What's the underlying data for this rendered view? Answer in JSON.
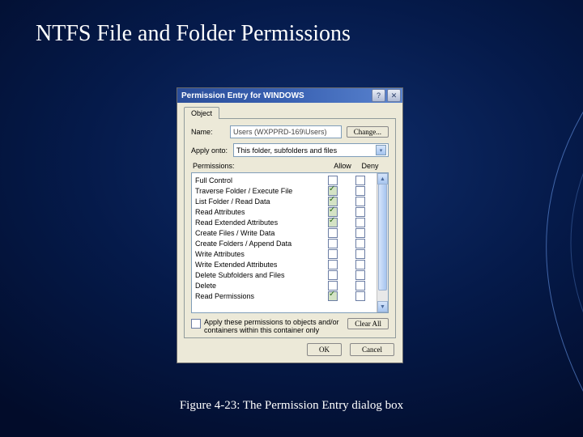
{
  "slide": {
    "title": "NTFS File and Folder Permissions",
    "caption": "Figure 4-23: The Permission Entry dialog box"
  },
  "dialog": {
    "title": "Permission Entry for WINDOWS",
    "help": "?",
    "close": "✕",
    "tab": "Object",
    "name_label": "Name:",
    "name_value": "Users (WXPPRD-169\\Users)",
    "change_btn": "Change...",
    "apply_label": "Apply onto:",
    "apply_value": "This folder, subfolders and files",
    "perm_header": "Permissions:",
    "allow_header": "Allow",
    "deny_header": "Deny",
    "permissions": [
      {
        "name": "Full Control",
        "allow": false,
        "deny": false
      },
      {
        "name": "Traverse Folder / Execute File",
        "allow": true,
        "deny": false
      },
      {
        "name": "List Folder / Read Data",
        "allow": true,
        "deny": false
      },
      {
        "name": "Read Attributes",
        "allow": true,
        "deny": false
      },
      {
        "name": "Read Extended Attributes",
        "allow": true,
        "deny": false
      },
      {
        "name": "Create Files / Write Data",
        "allow": false,
        "deny": false
      },
      {
        "name": "Create Folders / Append Data",
        "allow": false,
        "deny": false
      },
      {
        "name": "Write Attributes",
        "allow": false,
        "deny": false
      },
      {
        "name": "Write Extended Attributes",
        "allow": false,
        "deny": false
      },
      {
        "name": "Delete Subfolders and Files",
        "allow": false,
        "deny": false
      },
      {
        "name": "Delete",
        "allow": false,
        "deny": false
      },
      {
        "name": "Read Permissions",
        "allow": true,
        "deny": false
      }
    ],
    "inherit_text": "Apply these permissions to objects and/or containers within this container only",
    "clear_btn": "Clear All",
    "ok_btn": "OK",
    "cancel_btn": "Cancel"
  }
}
